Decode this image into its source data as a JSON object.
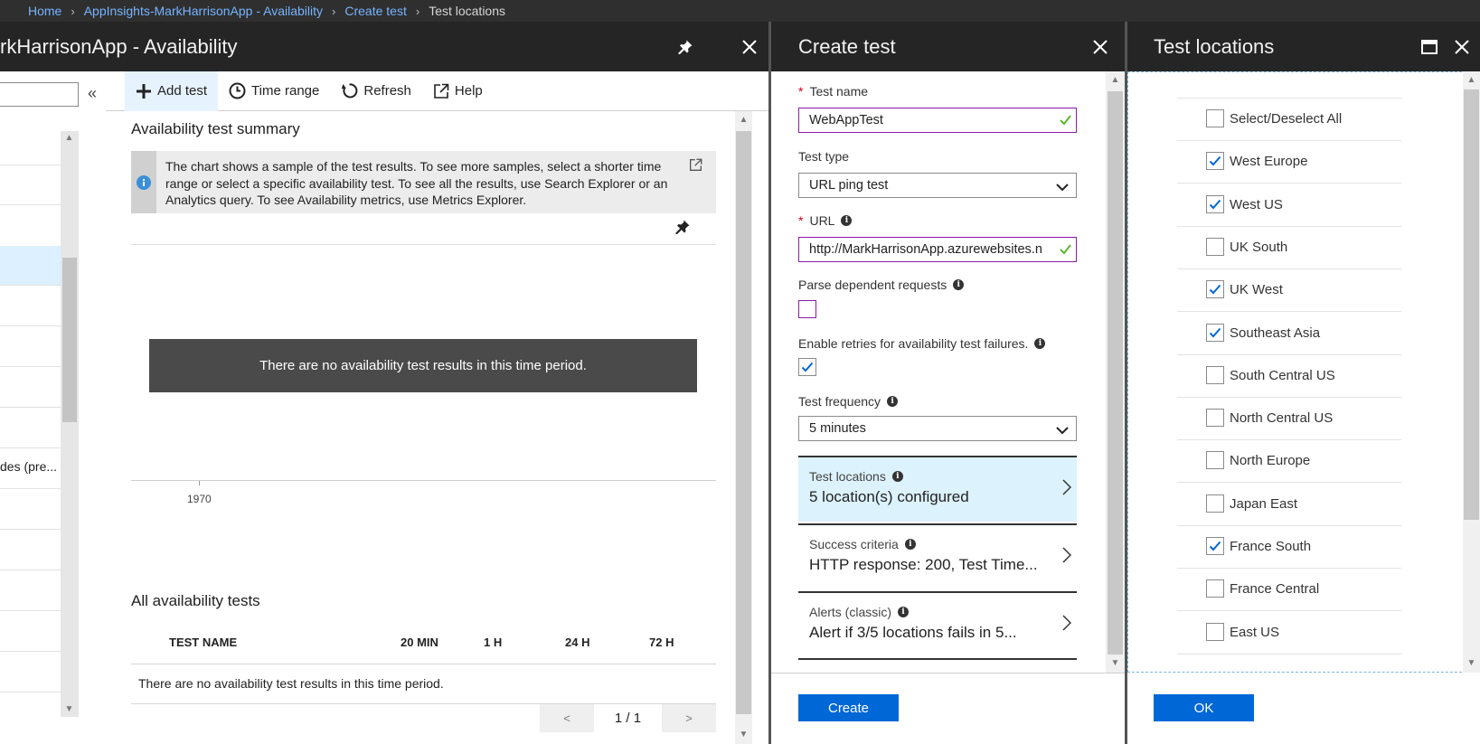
{
  "breadcrumb": {
    "home": "Home",
    "availability": "AppInsights-MarkHarrisonApp - Availability",
    "create_test": "Create test",
    "current": "Test locations"
  },
  "availability_blade": {
    "title": "rkHarrisonApp - Availability",
    "left_nav": {
      "partial_item": "des (pre..."
    },
    "toolbar": {
      "add_test": "Add test",
      "time_range": "Time range",
      "refresh": "Refresh",
      "help": "Help"
    },
    "summary_title": "Availability test summary",
    "info_message": "The chart shows a sample of the test results. To see more samples, select a shorter time range or select a specific availability test. To see all the results, use Search Explorer or an Analytics query. To see Availability metrics, use Metrics Explorer.",
    "chart_empty_message": "There are no availability test results in this time period.",
    "chart_x_tick": "1970",
    "all_tests_title": "All availability tests",
    "table_headers": [
      "TEST NAME",
      "20 MIN",
      "1 H",
      "24 H",
      "72 H"
    ],
    "table_empty_message": "There are no availability test results in this time period.",
    "pager": {
      "prev": "<",
      "page": "1 / 1",
      "next": ">"
    }
  },
  "create_test_blade": {
    "title": "Create test",
    "test_name": {
      "label": "Test name",
      "value": "WebAppTest"
    },
    "test_type": {
      "label": "Test type",
      "value": "URL ping test"
    },
    "url": {
      "label": "URL",
      "value": "http://MarkHarrisonApp.azurewebsites.n"
    },
    "parse_dependent": {
      "label": "Parse dependent requests",
      "checked": false
    },
    "enable_retries": {
      "label": "Enable retries for availability test failures.",
      "checked": true
    },
    "test_frequency": {
      "label": "Test frequency",
      "value": "5 minutes"
    },
    "nav_items": [
      {
        "label": "Test locations",
        "value": "5 location(s) configured"
      },
      {
        "label": "Success criteria",
        "value": "HTTP response: 200, Test Time..."
      },
      {
        "label": "Alerts (classic)",
        "value": "Alert if 3/5 locations fails in 5..."
      }
    ],
    "create_button": "Create"
  },
  "locations_blade": {
    "title": "Test locations",
    "locations": [
      {
        "name": "Select/Deselect All",
        "checked": false
      },
      {
        "name": "West Europe",
        "checked": true
      },
      {
        "name": "West US",
        "checked": true
      },
      {
        "name": "UK South",
        "checked": false
      },
      {
        "name": "UK West",
        "checked": true
      },
      {
        "name": "Southeast Asia",
        "checked": true
      },
      {
        "name": "South Central US",
        "checked": false
      },
      {
        "name": "North Central US",
        "checked": false
      },
      {
        "name": "North Europe",
        "checked": false
      },
      {
        "name": "Japan East",
        "checked": false
      },
      {
        "name": "France South",
        "checked": true
      },
      {
        "name": "France Central",
        "checked": false
      },
      {
        "name": "East US",
        "checked": false
      }
    ],
    "ok_button": "OK"
  },
  "colors": {
    "link": "#76b4ff",
    "header_bg": "#252525",
    "primary_button": "#0067d6",
    "active_nav_bg": "#dcf2fc",
    "invalid_border": "#8c1aa6",
    "valid_check": "#5cb82e",
    "checkbox_check": "#0067d6"
  },
  "icons": [
    "pin-icon",
    "close-icon",
    "maximize-icon",
    "plus-icon",
    "clock-icon",
    "refresh-icon",
    "external-link-icon",
    "info-icon",
    "chevron-down-icon",
    "chevron-right-icon",
    "checkmark-icon",
    "collapse-icon"
  ]
}
